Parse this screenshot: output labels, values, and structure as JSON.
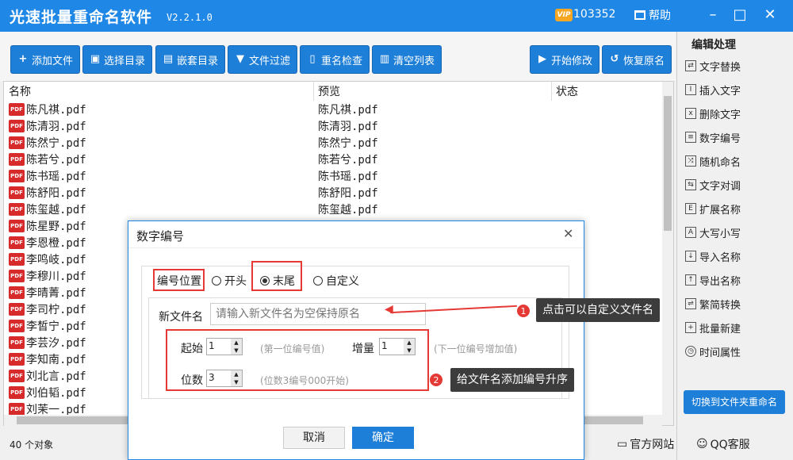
{
  "app": {
    "title": "光速批量重命名软件",
    "version": "V2.2.1.0",
    "vip_badge": "VIP",
    "vip_number": "103352",
    "help": "帮助"
  },
  "toolbar": {
    "add_files": "添加文件",
    "select_dir": "选择目录",
    "nested_dir": "嵌套目录",
    "file_filter": "文件过滤",
    "dup_check": "重名检查",
    "clear_list": "清空列表",
    "start": "开始修改",
    "restore": "恢复原名"
  },
  "sidebar": {
    "title": "编辑处理",
    "items": [
      {
        "label": "文字替换",
        "icon": "replace-icon"
      },
      {
        "label": "插入文字",
        "icon": "insert-icon"
      },
      {
        "label": "删除文字",
        "icon": "delete-icon"
      },
      {
        "label": "数字编号",
        "icon": "number-icon"
      },
      {
        "label": "随机命名",
        "icon": "shuffle-icon"
      },
      {
        "label": "文字对调",
        "icon": "swap-icon"
      },
      {
        "label": "扩展名称",
        "icon": "extension-icon"
      },
      {
        "label": "大写小写",
        "icon": "case-icon"
      },
      {
        "label": "导入名称",
        "icon": "import-icon"
      },
      {
        "label": "导出名称",
        "icon": "export-icon"
      },
      {
        "label": "繁简转换",
        "icon": "convert-icon"
      },
      {
        "label": "批量新建",
        "icon": "new-icon"
      },
      {
        "label": "时间属性",
        "icon": "clock-icon"
      }
    ],
    "switch": "切换到文件夹重命名"
  },
  "list": {
    "headers": {
      "name": "名称",
      "preview": "预览",
      "status": "状态"
    },
    "pdf_label": "PDF",
    "rows": [
      {
        "name": "陈凡祺.pdf",
        "preview": "陈凡祺.pdf"
      },
      {
        "name": "陈清羽.pdf",
        "preview": "陈清羽.pdf"
      },
      {
        "name": "陈然宁.pdf",
        "preview": "陈然宁.pdf"
      },
      {
        "name": "陈若兮.pdf",
        "preview": "陈若兮.pdf"
      },
      {
        "name": "陈书瑶.pdf",
        "preview": "陈书瑶.pdf"
      },
      {
        "name": "陈舒阳.pdf",
        "preview": "陈舒阳.pdf"
      },
      {
        "name": "陈玺越.pdf",
        "preview": "陈玺越.pdf"
      },
      {
        "name": "陈星野.pdf",
        "preview": ""
      },
      {
        "name": "李恩橙.pdf",
        "preview": ""
      },
      {
        "name": "李鸣岐.pdf",
        "preview": ""
      },
      {
        "name": "李穆川.pdf",
        "preview": ""
      },
      {
        "name": "李晴菁.pdf",
        "preview": ""
      },
      {
        "name": "李司柠.pdf",
        "preview": ""
      },
      {
        "name": "李皙宁.pdf",
        "preview": ""
      },
      {
        "name": "李芸汐.pdf",
        "preview": ""
      },
      {
        "name": "李知南.pdf",
        "preview": ""
      },
      {
        "name": "刘北言.pdf",
        "preview": ""
      },
      {
        "name": "刘伯韬.pdf",
        "preview": ""
      },
      {
        "name": "刘茉一.pdf",
        "preview": ""
      }
    ]
  },
  "status": {
    "count": "40 个对象",
    "site": "官方网站",
    "qq": "QQ客服"
  },
  "dialog": {
    "title": "数字编号",
    "position_label": "编号位置",
    "opt_start": "开头",
    "opt_end": "末尾",
    "opt_custom": "自定义",
    "newname_label": "新文件名",
    "newname_placeholder": "请输入新文件名为空保持原名",
    "start_label": "起始",
    "start_value": "1",
    "start_hint": "(第一位编号值)",
    "inc_label": "增量",
    "inc_value": "1",
    "inc_hint": "(下一位编号增加值)",
    "digits_label": "位数",
    "digits_value": "3",
    "digits_hint": "(位数3编号000开始)",
    "cancel": "取消",
    "ok": "确定"
  },
  "callouts": {
    "one_num": "1",
    "one_text": "点击可以自定义文件名",
    "two_num": "2",
    "two_text": "给文件名添加编号升序"
  },
  "colors": {
    "accent": "#1f87e6",
    "highlight": "#e53935"
  }
}
